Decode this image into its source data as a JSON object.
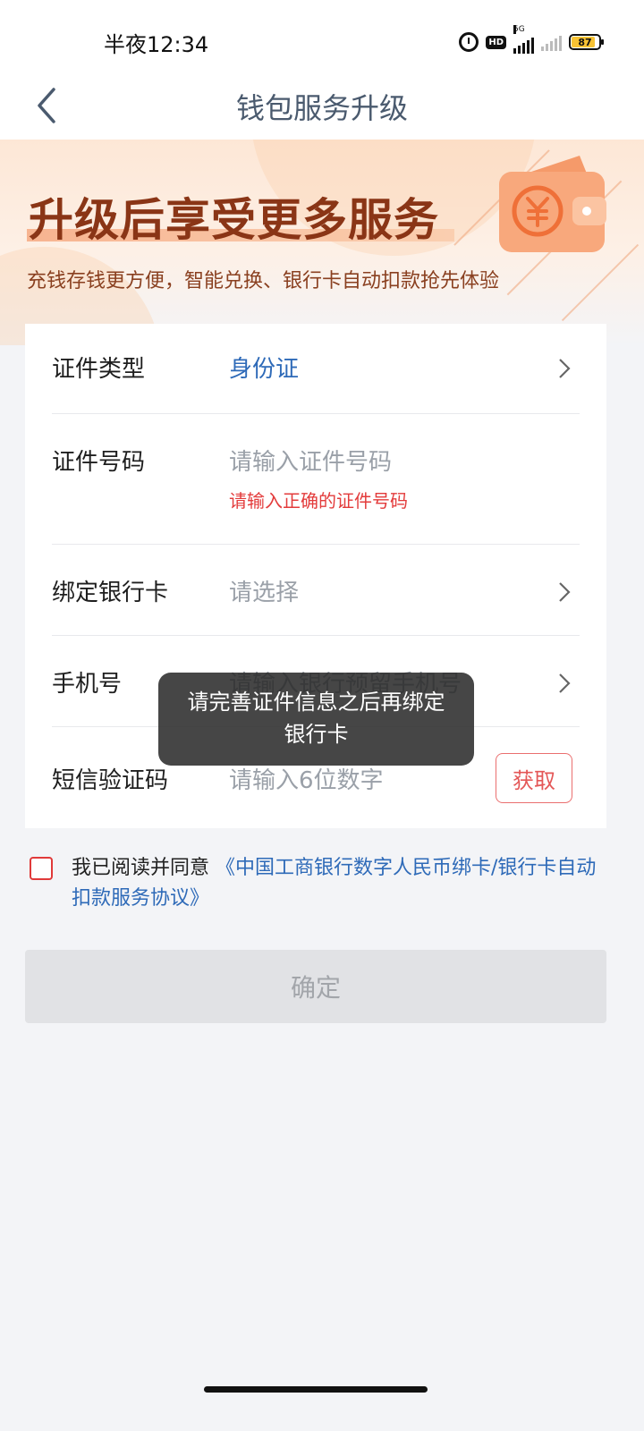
{
  "status_bar": {
    "time": "半夜12:34",
    "network": "5G",
    "hd": "HD",
    "battery": "87"
  },
  "nav": {
    "title": "钱包服务升级"
  },
  "banner": {
    "title": "升级后享受更多服务",
    "subtitle": "充钱存钱更方便，智能兑换、银行卡自动扣款抢先体验"
  },
  "form": {
    "id_type": {
      "label": "证件类型",
      "value": "身份证"
    },
    "id_number": {
      "label": "证件号码",
      "placeholder": "请输入证件号码",
      "error": "请输入正确的证件号码"
    },
    "bank_card": {
      "label": "绑定银行卡",
      "placeholder": "请选择"
    },
    "phone": {
      "label": "手机号",
      "placeholder": "请输入银行预留手机号"
    },
    "sms": {
      "label": "短信验证码",
      "placeholder": "请输入6位数字",
      "button": "获取"
    }
  },
  "agreement": {
    "prefix": "我已阅读并同意",
    "link": "《中国工商银行数字人民币绑卡/银行卡自动扣款服务协议》"
  },
  "confirm_label": "确定",
  "toast": "请完善证件信息之后再绑定银行卡",
  "colors": {
    "accent_blue": "#2e6ab8",
    "error_red": "#e33b3b",
    "banner_title": "#8a3516"
  }
}
